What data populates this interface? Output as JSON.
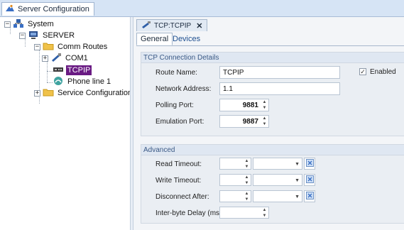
{
  "window": {
    "tab_title": "Server Configuration"
  },
  "tree": {
    "items": [
      {
        "label": "System",
        "icon": "network-icon",
        "expander": "−"
      },
      {
        "label": "SERVER",
        "icon": "server-icon",
        "expander": "−"
      },
      {
        "label": "Comm Routes",
        "icon": "folder-icon",
        "expander": "−"
      },
      {
        "label": "COM1",
        "icon": "serial-port-icon",
        "expander": "+"
      },
      {
        "label": "TCPIP",
        "icon": "network-card-icon",
        "selected": true
      },
      {
        "label": "Phone line 1",
        "icon": "phone-icon"
      },
      {
        "label": "Service Configuration",
        "icon": "folder-icon",
        "expander": "+"
      }
    ]
  },
  "main": {
    "tab_label": "TCP:TCPIP",
    "close": "✕",
    "inner_tabs": [
      "General",
      "Devices"
    ],
    "tcp_section": {
      "title": "TCP Connection Details",
      "route_name_label": "Route Name:",
      "route_name_value": "TCPIP",
      "enabled_label": "Enabled",
      "enabled_checked": true,
      "network_address_label": "Network Address:",
      "network_address_value": "1.1",
      "polling_port_label": "Polling Port:",
      "polling_port_value": "9881",
      "emulation_port_label": "Emulation Port:",
      "emulation_port_value": "9887"
    },
    "advanced_section": {
      "title": "Advanced",
      "read_timeout_label": "Read Timeout:",
      "write_timeout_label": "Write Timeout:",
      "disconnect_after_label": "Disconnect After:",
      "inter_byte_delay_label": "Inter-byte Delay (ms):"
    }
  },
  "colors": {
    "selection": "#6a1b83",
    "section_title": "#3b5a86",
    "tab_strip": "#d6e4f5"
  }
}
